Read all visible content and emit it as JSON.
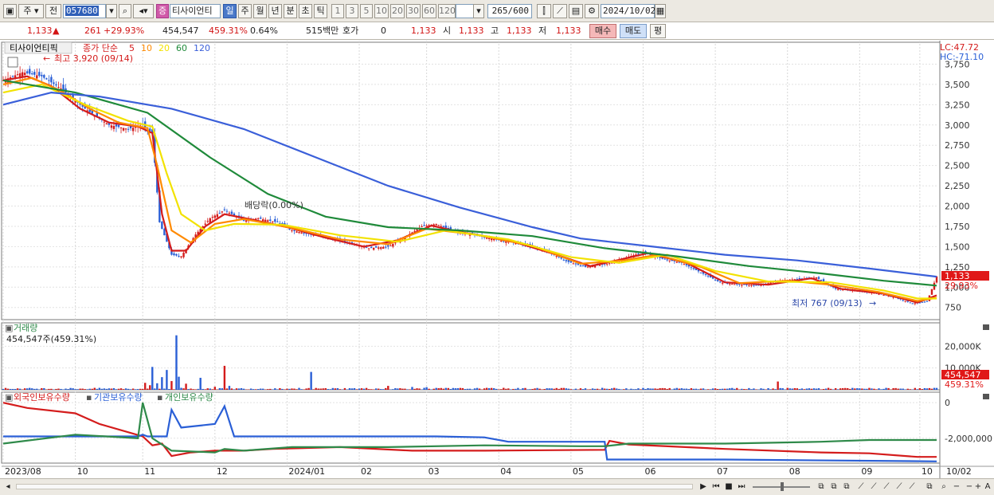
{
  "toolbar": {
    "period_select": "주",
    "all_label": "전",
    "code": "057680",
    "stock_name": "티사이언티",
    "stock_badge": "증",
    "periods": [
      "일",
      "주",
      "월",
      "년",
      "분",
      "초",
      "틱"
    ],
    "active_period": "일",
    "intervals": [
      "1",
      "3",
      "5",
      "10",
      "20",
      "30",
      "60",
      "120"
    ],
    "count": "265",
    "count_total": "/600",
    "date": "2024/10/02"
  },
  "quote": {
    "price": "1,133",
    "change": "261",
    "change_pct": "+29.93%",
    "volume": "454,547",
    "volume_pct": "459.31%",
    "turnover_pct": "0.64%",
    "amount": "515백만",
    "hoga_label": "호가",
    "hoga_value": "0",
    "hoga_price": "1,133",
    "open_label": "시",
    "open": "1,133",
    "high_label": "고",
    "high": "1,133",
    "low_label": "저",
    "low": "1,133",
    "buy_label": "매수",
    "sell_label": "매도",
    "eval_label": "평"
  },
  "price_panel": {
    "name_label": "티사이언티픽",
    "ma_label": "종가 단순",
    "ma_periods": [
      "5",
      "10",
      "20",
      "60",
      "120"
    ],
    "ma_colors": [
      "#d41c1c",
      "#ff8a00",
      "#f2e200",
      "#1f8a3a",
      "#3a5fd9"
    ],
    "lc": "LC:47.72",
    "hc": "HC:-71.10",
    "high_annotation": "최고 3,920 (09/14)",
    "low_annotation": "최저 767 (09/13)",
    "event_annotation": "배당락(0.00%)",
    "current_price_tag": "1,133",
    "current_pct_tag": "29.93%"
  },
  "volume_panel": {
    "title": "거래량",
    "value_label": "454,547주(459.31%)",
    "current_tag": "454,547",
    "current_pct_tag": "459.31%"
  },
  "holdings_panel": {
    "legend": [
      "외국인보유수량",
      "기관보유수량",
      "개인보유수량"
    ],
    "colors": [
      "#d41c1c",
      "#2a5fd6",
      "#2f8a4a"
    ]
  },
  "chart_data": [
    {
      "type": "candlestick",
      "title": "티사이언티픽",
      "y_ticks": [
        750,
        1000,
        1250,
        1500,
        1750,
        2000,
        2250,
        2500,
        2750,
        3000,
        3250,
        3500,
        3750
      ],
      "y_tick_labels": [
        "750",
        "1,000",
        "1,250",
        "1,500",
        "1,750",
        "2,000",
        "2,250",
        "2,500",
        "2,750",
        "3,000",
        "3,250",
        "3,500",
        "3,750"
      ],
      "ylim": [
        600,
        4000
      ],
      "x_tick_labels": [
        "2023/08",
        "10",
        "11",
        "12",
        "2024/01",
        "02",
        "03",
        "04",
        "05",
        "06",
        "07",
        "08",
        "09",
        "10",
        "10/02"
      ],
      "close_points": [
        [
          0,
          3550
        ],
        [
          8,
          3650
        ],
        [
          16,
          3600
        ],
        [
          24,
          3450
        ],
        [
          34,
          3200
        ],
        [
          44,
          3000
        ],
        [
          52,
          2950
        ],
        [
          58,
          3000
        ],
        [
          62,
          2900
        ],
        [
          65,
          1800
        ],
        [
          70,
          1400
        ],
        [
          74,
          1380
        ],
        [
          80,
          1650
        ],
        [
          86,
          1850
        ],
        [
          92,
          1950
        ],
        [
          100,
          1820
        ],
        [
          106,
          1850
        ],
        [
          114,
          1800
        ],
        [
          120,
          1700
        ],
        [
          128,
          1650
        ],
        [
          136,
          1600
        ],
        [
          144,
          1550
        ],
        [
          152,
          1480
        ],
        [
          160,
          1500
        ],
        [
          166,
          1600
        ],
        [
          174,
          1750
        ],
        [
          180,
          1780
        ],
        [
          188,
          1680
        ],
        [
          196,
          1640
        ],
        [
          206,
          1580
        ],
        [
          216,
          1530
        ],
        [
          226,
          1450
        ],
        [
          234,
          1320
        ],
        [
          242,
          1250
        ],
        [
          250,
          1280
        ],
        [
          258,
          1360
        ],
        [
          266,
          1430
        ],
        [
          274,
          1350
        ],
        [
          282,
          1300
        ],
        [
          290,
          1180
        ],
        [
          298,
          1060
        ],
        [
          306,
          1030
        ],
        [
          314,
          1020
        ],
        [
          322,
          1080
        ],
        [
          330,
          1100
        ],
        [
          338,
          1120
        ],
        [
          346,
          980
        ],
        [
          354,
          960
        ],
        [
          362,
          930
        ],
        [
          370,
          880
        ],
        [
          378,
          800
        ],
        [
          384,
          820
        ],
        [
          388,
          1133
        ]
      ],
      "ma_points": [
        {
          "name": "5",
          "values": [
            [
              0,
              3550
            ],
            [
              10,
              3600
            ],
            [
              20,
              3480
            ],
            [
              32,
              3200
            ],
            [
              44,
              3030
            ],
            [
              56,
              2980
            ],
            [
              62,
              2900
            ],
            [
              66,
              1900
            ],
            [
              70,
              1450
            ],
            [
              76,
              1450
            ],
            [
              84,
              1750
            ],
            [
              92,
              1900
            ],
            [
              104,
              1830
            ],
            [
              118,
              1740
            ],
            [
              134,
              1610
            ],
            [
              150,
              1500
            ],
            [
              164,
              1580
            ],
            [
              178,
              1760
            ],
            [
              190,
              1680
            ],
            [
              210,
              1580
            ],
            [
              230,
              1400
            ],
            [
              244,
              1260
            ],
            [
              258,
              1350
            ],
            [
              268,
              1420
            ],
            [
              284,
              1300
            ],
            [
              300,
              1060
            ],
            [
              318,
              1030
            ],
            [
              336,
              1110
            ],
            [
              348,
              980
            ],
            [
              366,
              920
            ],
            [
              380,
              810
            ],
            [
              388,
              900
            ]
          ]
        },
        {
          "name": "10",
          "values": [
            [
              0,
              3500
            ],
            [
              12,
              3580
            ],
            [
              24,
              3420
            ],
            [
              36,
              3200
            ],
            [
              48,
              3030
            ],
            [
              60,
              2960
            ],
            [
              64,
              2500
            ],
            [
              70,
              1700
            ],
            [
              78,
              1550
            ],
            [
              88,
              1780
            ],
            [
              100,
              1840
            ],
            [
              120,
              1730
            ],
            [
              140,
              1590
            ],
            [
              160,
              1530
            ],
            [
              176,
              1720
            ],
            [
              196,
              1650
            ],
            [
              220,
              1510
            ],
            [
              240,
              1290
            ],
            [
              258,
              1330
            ],
            [
              272,
              1400
            ],
            [
              290,
              1250
            ],
            [
              306,
              1050
            ],
            [
              326,
              1080
            ],
            [
              344,
              1030
            ],
            [
              364,
              940
            ],
            [
              380,
              830
            ],
            [
              388,
              870
            ]
          ]
        },
        {
          "name": "20",
          "values": [
            [
              0,
              3400
            ],
            [
              16,
              3500
            ],
            [
              34,
              3250
            ],
            [
              52,
              3050
            ],
            [
              62,
              2980
            ],
            [
              68,
              2400
            ],
            [
              74,
              1900
            ],
            [
              84,
              1700
            ],
            [
              96,
              1780
            ],
            [
              116,
              1770
            ],
            [
              140,
              1640
            ],
            [
              164,
              1560
            ],
            [
              184,
              1700
            ],
            [
              210,
              1590
            ],
            [
              236,
              1370
            ],
            [
              256,
              1300
            ],
            [
              276,
              1400
            ],
            [
              296,
              1200
            ],
            [
              318,
              1070
            ],
            [
              344,
              1060
            ],
            [
              366,
              960
            ],
            [
              380,
              860
            ],
            [
              388,
              860
            ]
          ]
        },
        {
          "name": "60",
          "values": [
            [
              0,
              3550
            ],
            [
              30,
              3400
            ],
            [
              60,
              3150
            ],
            [
              86,
              2600
            ],
            [
              110,
              2150
            ],
            [
              134,
              1870
            ],
            [
              160,
              1740
            ],
            [
              190,
              1700
            ],
            [
              220,
              1630
            ],
            [
              250,
              1480
            ],
            [
              280,
              1380
            ],
            [
              310,
              1260
            ],
            [
              340,
              1170
            ],
            [
              366,
              1080
            ],
            [
              388,
              1020
            ]
          ]
        },
        {
          "name": "120",
          "values": [
            [
              0,
              3250
            ],
            [
              20,
              3400
            ],
            [
              40,
              3350
            ],
            [
              70,
              3200
            ],
            [
              100,
              2950
            ],
            [
              130,
              2600
            ],
            [
              160,
              2250
            ],
            [
              190,
              1980
            ],
            [
              220,
              1740
            ],
            [
              240,
              1600
            ],
            [
              270,
              1500
            ],
            [
              300,
              1400
            ],
            [
              330,
              1330
            ],
            [
              360,
              1230
            ],
            [
              388,
              1130
            ]
          ]
        }
      ]
    },
    {
      "type": "bar",
      "title": "거래량",
      "y_tick_labels": [
        "10,000K",
        "20,000K"
      ],
      "y_ticks": [
        10000,
        20000
      ],
      "ylim": [
        0,
        30000
      ],
      "spikes": [
        [
          59,
          3200
        ],
        [
          61,
          2100
        ],
        [
          62,
          10500
        ],
        [
          64,
          3000
        ],
        [
          66,
          5800
        ],
        [
          68,
          9100
        ],
        [
          70,
          4000
        ],
        [
          72,
          25000
        ],
        [
          73,
          6000
        ],
        [
          76,
          2800
        ],
        [
          82,
          5500
        ],
        [
          88,
          1400
        ],
        [
          92,
          11000
        ],
        [
          94,
          1800
        ],
        [
          128,
          8200
        ],
        [
          160,
          1800
        ],
        [
          170,
          1300
        ],
        [
          176,
          1200
        ],
        [
          322,
          3800
        ]
      ],
      "base_volume": [
        150,
        900
      ]
    },
    {
      "type": "line",
      "title": "보유수량",
      "y_tick_labels": [
        "0",
        "-2,000,000"
      ],
      "y_ticks": [
        0,
        -2000000
      ],
      "ylim": [
        -3400000,
        500000
      ],
      "series": [
        {
          "name": "외국인보유수량",
          "values": [
            [
              0,
              0
            ],
            [
              10,
              -300000
            ],
            [
              30,
              -600000
            ],
            [
              40,
              -1200000
            ],
            [
              58,
              -1900000
            ],
            [
              62,
              -2400000
            ],
            [
              66,
              -2300000
            ],
            [
              70,
              -3000000
            ],
            [
              78,
              -2800000
            ],
            [
              88,
              -2700000
            ],
            [
              100,
              -2700000
            ],
            [
              112,
              -2600000
            ],
            [
              140,
              -2500000
            ],
            [
              170,
              -2700000
            ],
            [
              200,
              -2700000
            ],
            [
              250,
              -2650000
            ],
            [
              252,
              -2150000
            ],
            [
              260,
              -2350000
            ],
            [
              300,
              -2600000
            ],
            [
              340,
              -2800000
            ],
            [
              360,
              -2850000
            ],
            [
              380,
              -3050000
            ],
            [
              388,
              -3050000
            ]
          ]
        },
        {
          "name": "기관보유수량",
          "values": [
            [
              0,
              -1900000
            ],
            [
              40,
              -1900000
            ],
            [
              56,
              -1900000
            ],
            [
              58,
              -1800000
            ],
            [
              60,
              -1900000
            ],
            [
              68,
              -1900000
            ],
            [
              70,
              -400000
            ],
            [
              74,
              -1400000
            ],
            [
              88,
              -1200000
            ],
            [
              92,
              -200000
            ],
            [
              96,
              -1900000
            ],
            [
              180,
              -1900000
            ],
            [
              200,
              -1950000
            ],
            [
              210,
              -2200000
            ],
            [
              250,
              -2200000
            ],
            [
              251,
              -3200000
            ],
            [
              300,
              -3200000
            ],
            [
              388,
              -3300000
            ]
          ]
        },
        {
          "name": "개인보유수량",
          "values": [
            [
              0,
              -2300000
            ],
            [
              30,
              -1800000
            ],
            [
              56,
              -2000000
            ],
            [
              58,
              0
            ],
            [
              62,
              -2000000
            ],
            [
              70,
              -2700000
            ],
            [
              88,
              -2800000
            ],
            [
              92,
              -2600000
            ],
            [
              100,
              -2700000
            ],
            [
              120,
              -2500000
            ],
            [
              160,
              -2500000
            ],
            [
              200,
              -2400000
            ],
            [
              240,
              -2450000
            ],
            [
              250,
              -2450000
            ],
            [
              260,
              -2300000
            ],
            [
              300,
              -2300000
            ],
            [
              340,
              -2200000
            ],
            [
              360,
              -2100000
            ],
            [
              380,
              -2100000
            ],
            [
              388,
              -2100000
            ]
          ]
        }
      ]
    }
  ]
}
